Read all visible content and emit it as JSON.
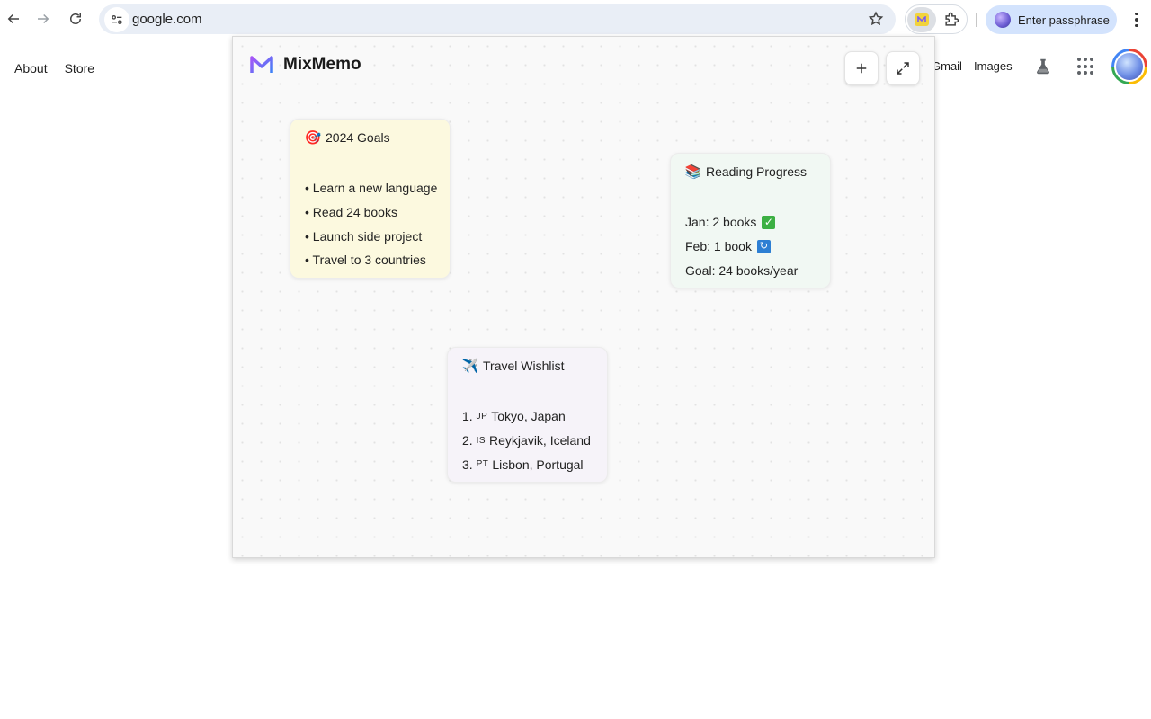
{
  "browser": {
    "url": "google.com",
    "passphrase_label": "Enter passphrase",
    "icons": [
      "back-arrow-icon",
      "forward-arrow-icon",
      "reload-icon",
      "site-info-icon",
      "bookmark-star-icon",
      "mixmemo-extension-icon",
      "extensions-puzzle-icon",
      "profile-icon",
      "more-menu-icon"
    ]
  },
  "google": {
    "left_links": [
      "About",
      "Store"
    ],
    "right_links": {
      "gmail": "Gmail",
      "images": "Images"
    }
  },
  "popup": {
    "brand": "MixMemo",
    "accent_colors": [
      "#8a5cf6",
      "#3b82f6"
    ],
    "notes": [
      {
        "title": "2024 Goals",
        "emoji": "🎯",
        "bg": "#fcf9df",
        "lines": [
          "• Learn a new language",
          "• Read 24 books",
          "• Launch side project",
          "• Travel to 3 countries"
        ]
      },
      {
        "title": "Reading Progress",
        "emoji": "📚",
        "bg": "#f1f8f3",
        "lines": [
          {
            "text": "Jan: 2 books",
            "badge": "✓"
          },
          {
            "text": "Feb: 1 book",
            "badge": "↻"
          },
          {
            "text": "Goal: 24 books/year"
          }
        ]
      },
      {
        "title": "Travel Wishlist",
        "emoji": "✈️",
        "bg": "#f6f3f9",
        "lines": [
          {
            "prefix": "1.",
            "flag": "JP",
            "text": "Tokyo, Japan"
          },
          {
            "prefix": "2.",
            "flag": "IS",
            "text": "Reykjavik, Iceland"
          },
          {
            "prefix": "3.",
            "flag": "PT",
            "text": "Lisbon, Portugal"
          }
        ]
      }
    ]
  }
}
